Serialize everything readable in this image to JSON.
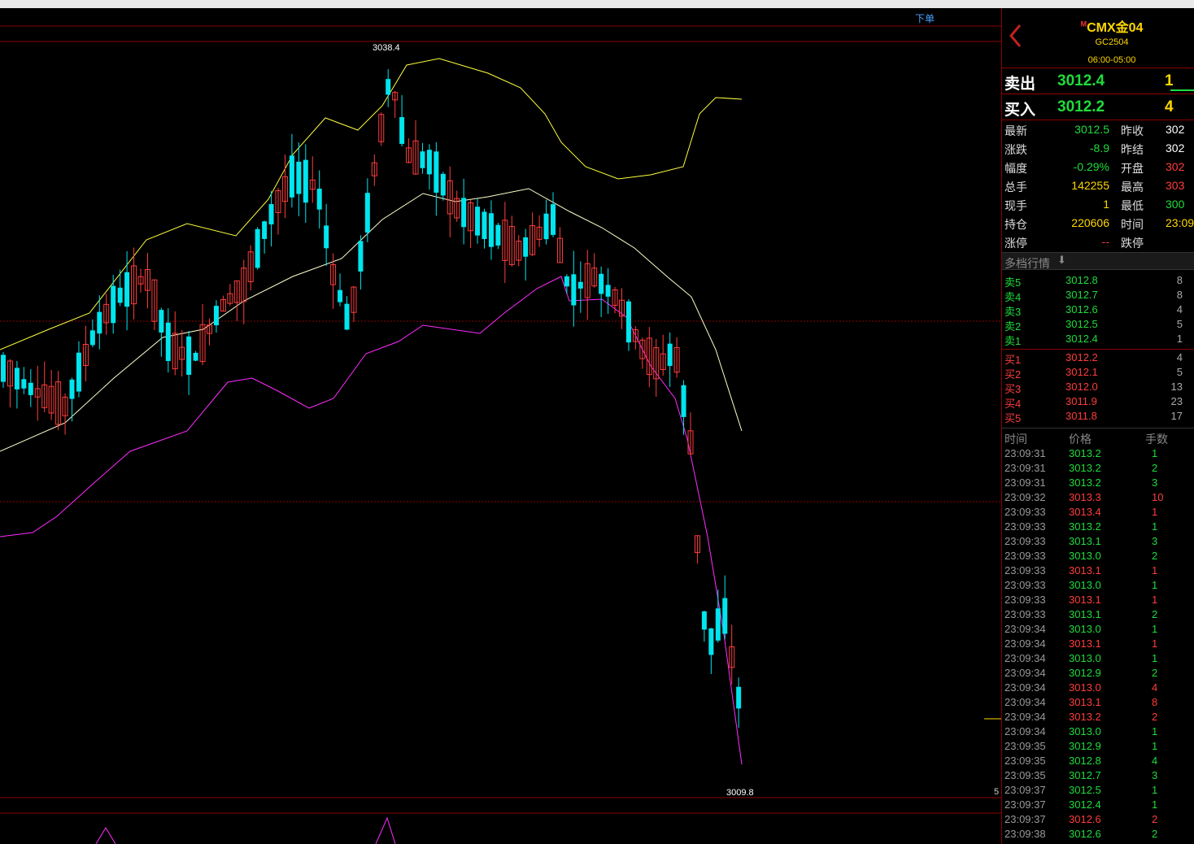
{
  "chart": {
    "order_button": "下单",
    "high_label": "3038.4",
    "low_label": "3009.8",
    "axis_label": "5"
  },
  "panel": {
    "symbol_badge": "M",
    "symbol_name": "CMX金04",
    "symbol_code": "GC2504",
    "session": "06:00-05:00",
    "ask": {
      "label": "卖出",
      "price": "3012.4",
      "volume": "1"
    },
    "bid": {
      "label": "买入",
      "price": "3012.2",
      "volume": "4"
    },
    "stats": [
      {
        "label": "最新",
        "value": "3012.5",
        "color": "#1fdc3c",
        "label2": "昨收",
        "value2": "302",
        "color2": "#ffffff"
      },
      {
        "label": "涨跌",
        "value": "-8.9",
        "color": "#1fdc3c",
        "label2": "昨结",
        "value2": "302",
        "color2": "#ffffff"
      },
      {
        "label": "幅度",
        "value": "-0.29%",
        "color": "#1fdc3c",
        "label2": "开盘",
        "value2": "302",
        "color2": "#ff3c3c"
      },
      {
        "label": "总手",
        "value": "142255",
        "color": "#ffd700",
        "label2": "最高",
        "value2": "303",
        "color2": "#ff3c3c"
      },
      {
        "label": "现手",
        "value": "1",
        "color": "#ffd700",
        "label2": "最低",
        "value2": "300",
        "color2": "#1fdc3c"
      },
      {
        "label": "持仓",
        "value": "220606",
        "color": "#ffd700",
        "label2": "时间",
        "value2": "23:09",
        "color2": "#ffd700"
      },
      {
        "label": "涨停",
        "value": "--",
        "color": "#ff3c3c",
        "label2": "跌停",
        "value2": "",
        "color2": "#1fdc3c"
      }
    ],
    "depth_title": "多档行情",
    "asks": [
      {
        "label": "卖5",
        "price": "3012.8",
        "volume": "8"
      },
      {
        "label": "卖4",
        "price": "3012.7",
        "volume": "8"
      },
      {
        "label": "卖3",
        "price": "3012.6",
        "volume": "4"
      },
      {
        "label": "卖2",
        "price": "3012.5",
        "volume": "5"
      },
      {
        "label": "卖1",
        "price": "3012.4",
        "volume": "1"
      }
    ],
    "bids": [
      {
        "label": "买1",
        "price": "3012.2",
        "volume": "4"
      },
      {
        "label": "买2",
        "price": "3012.1",
        "volume": "5"
      },
      {
        "label": "买3",
        "price": "3012.0",
        "volume": "13"
      },
      {
        "label": "买4",
        "price": "3011.9",
        "volume": "23"
      },
      {
        "label": "买5",
        "price": "3011.8",
        "volume": "17"
      }
    ],
    "ticks_header": {
      "time": "时间",
      "price": "价格",
      "volume": "手数"
    },
    "ticks": [
      {
        "time": "23:09:31",
        "price": "3013.2",
        "volume": "1",
        "dir": "down"
      },
      {
        "time": "23:09:31",
        "price": "3013.2",
        "volume": "2",
        "dir": "down"
      },
      {
        "time": "23:09:31",
        "price": "3013.2",
        "volume": "3",
        "dir": "down"
      },
      {
        "time": "23:09:32",
        "price": "3013.3",
        "volume": "10",
        "dir": "up"
      },
      {
        "time": "23:09:33",
        "price": "3013.4",
        "volume": "1",
        "dir": "up"
      },
      {
        "time": "23:09:33",
        "price": "3013.2",
        "volume": "1",
        "dir": "down"
      },
      {
        "time": "23:09:33",
        "price": "3013.1",
        "volume": "3",
        "dir": "down"
      },
      {
        "time": "23:09:33",
        "price": "3013.0",
        "volume": "2",
        "dir": "down"
      },
      {
        "time": "23:09:33",
        "price": "3013.1",
        "volume": "1",
        "dir": "up"
      },
      {
        "time": "23:09:33",
        "price": "3013.0",
        "volume": "1",
        "dir": "down"
      },
      {
        "time": "23:09:33",
        "price": "3013.1",
        "volume": "1",
        "dir": "up"
      },
      {
        "time": "23:09:33",
        "price": "3013.1",
        "volume": "2",
        "dir": "down"
      },
      {
        "time": "23:09:34",
        "price": "3013.0",
        "volume": "1",
        "dir": "down"
      },
      {
        "time": "23:09:34",
        "price": "3013.1",
        "volume": "1",
        "dir": "up"
      },
      {
        "time": "23:09:34",
        "price": "3013.0",
        "volume": "1",
        "dir": "down"
      },
      {
        "time": "23:09:34",
        "price": "3012.9",
        "volume": "2",
        "dir": "down"
      },
      {
        "time": "23:09:34",
        "price": "3013.0",
        "volume": "4",
        "dir": "up"
      },
      {
        "time": "23:09:34",
        "price": "3013.1",
        "volume": "8",
        "dir": "up"
      },
      {
        "time": "23:09:34",
        "price": "3013.2",
        "volume": "2",
        "dir": "up"
      },
      {
        "time": "23:09:34",
        "price": "3013.0",
        "volume": "1",
        "dir": "down"
      },
      {
        "time": "23:09:35",
        "price": "3012.9",
        "volume": "1",
        "dir": "down"
      },
      {
        "time": "23:09:35",
        "price": "3012.8",
        "volume": "4",
        "dir": "down"
      },
      {
        "time": "23:09:35",
        "price": "3012.7",
        "volume": "3",
        "dir": "down"
      },
      {
        "time": "23:09:37",
        "price": "3012.5",
        "volume": "1",
        "dir": "down"
      },
      {
        "time": "23:09:37",
        "price": "3012.4",
        "volume": "1",
        "dir": "down"
      },
      {
        "time": "23:09:37",
        "price": "3012.6",
        "volume": "2",
        "dir": "up"
      },
      {
        "time": "23:09:38",
        "price": "3012.6",
        "volume": "2",
        "dir": "down"
      }
    ],
    "colors": {
      "up": "#ff3c3c",
      "down": "#1fdc3c"
    }
  }
}
